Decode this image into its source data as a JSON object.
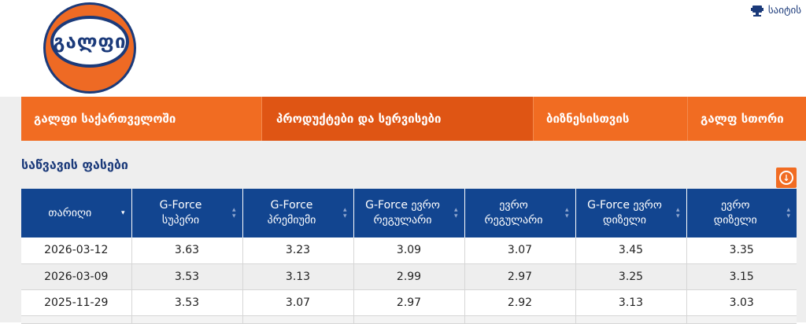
{
  "brand": {
    "logo_text": "გალფი",
    "primary_color": "#f16c22",
    "navy_color": "#1b3a7a"
  },
  "top_link": {
    "label": "საიტის",
    "icon": "monitor-icon"
  },
  "nav": {
    "items": [
      {
        "label": "გალფი საქართველოში",
        "active": false
      },
      {
        "label": "პროდუქტები და სერვისები",
        "active": true
      },
      {
        "label": "ბიზნესისთვის",
        "active": false
      },
      {
        "label": "გალფ სთორი",
        "active": false
      }
    ]
  },
  "prices": {
    "title": "საწვავის ფასები",
    "download_icon": "download-icon",
    "columns": [
      {
        "line1": "თარიღი",
        "line2": ""
      },
      {
        "line1": "G-Force",
        "line2": "სუპერი"
      },
      {
        "line1": "G-Force",
        "line2": "პრემიუმი"
      },
      {
        "line1": "G-Force ევრო",
        "line2": "რეგულარი"
      },
      {
        "line1": "ევრო",
        "line2": "რეგულარი"
      },
      {
        "line1": "G-Force ევრო",
        "line2": "დიზელი"
      },
      {
        "line1": "ევრო",
        "line2": "დიზელი"
      }
    ],
    "rows": [
      [
        "2026-03-12",
        "3.63",
        "3.23",
        "3.09",
        "3.07",
        "3.45",
        "3.35"
      ],
      [
        "2026-03-09",
        "3.53",
        "3.13",
        "2.99",
        "2.97",
        "3.25",
        "3.15"
      ],
      [
        "2025-11-29",
        "3.53",
        "3.07",
        "2.97",
        "2.92",
        "3.13",
        "3.03"
      ]
    ]
  }
}
